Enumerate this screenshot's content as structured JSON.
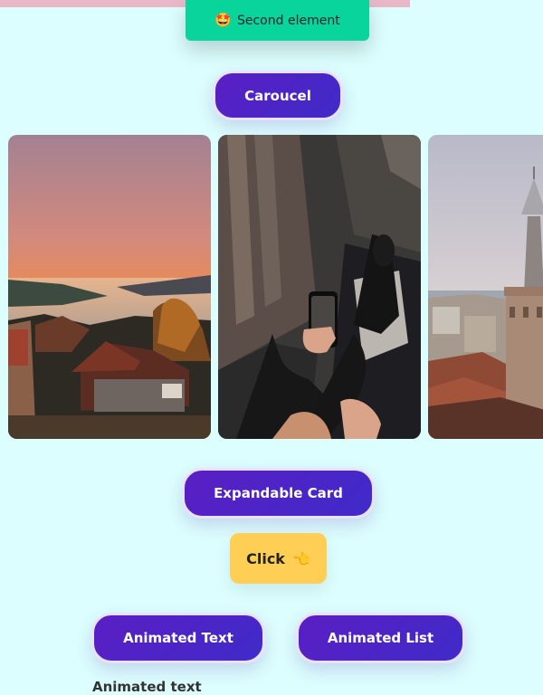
{
  "top": {
    "second_element": {
      "emoji": "🤩",
      "label": "Second element"
    }
  },
  "sections": {
    "carousel_button": "Caroucel",
    "expandable_card_button": "Expandable Card",
    "click_button": {
      "label": "Click",
      "icon": "pointing-hand-icon",
      "emoji": "👈"
    },
    "animated_text_button": "Animated Text",
    "animated_list_button": "Animated List",
    "animated_text_heading": "Animated text"
  },
  "carousel": {
    "slides": [
      {
        "name": "sunset-city-photo"
      },
      {
        "name": "person-holding-phone-photo"
      },
      {
        "name": "tower-city-photo"
      }
    ]
  },
  "colors": {
    "background": "#dcfefe",
    "accent_purple": "#4d24c6",
    "green": "#08d49b",
    "yellow": "#ffcf55"
  }
}
